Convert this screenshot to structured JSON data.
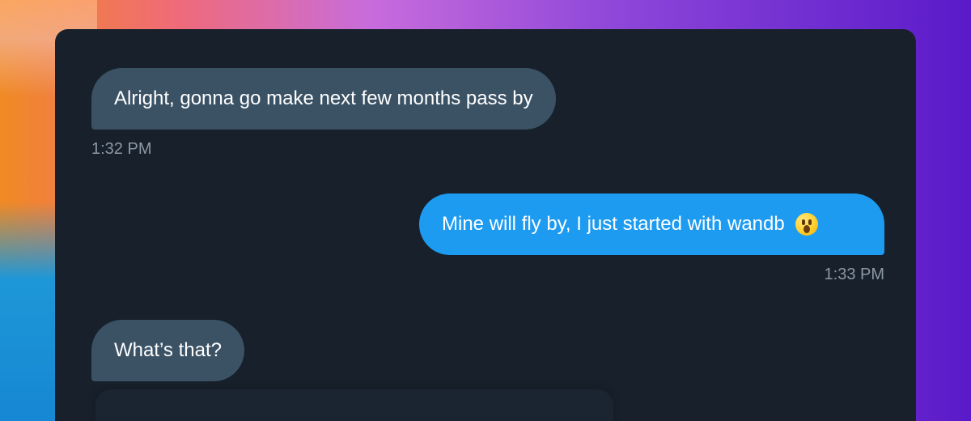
{
  "messages": [
    {
      "text": "Alright, gonna go make next few months pass by",
      "time": "1:32 PM",
      "direction": "incoming"
    },
    {
      "text": "Mine will fly by, I just started with wandb",
      "emoji": "astonished-face-icon",
      "time": "1:33 PM",
      "direction": "outgoing"
    },
    {
      "text": "What’s that?",
      "direction": "incoming"
    }
  ],
  "colors": {
    "incoming_bubble": "#3b5265",
    "outgoing_bubble": "#1d9bf0",
    "card_background": "#17202b",
    "timestamp": "#8b98a5"
  }
}
